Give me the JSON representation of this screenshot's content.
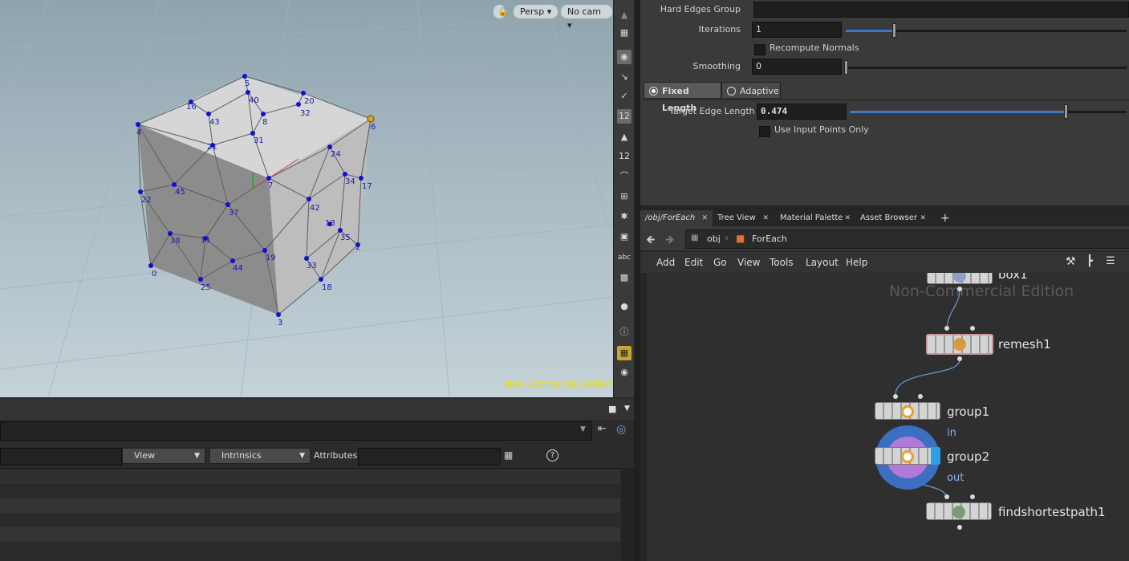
{
  "viewport": {
    "camera_view": "Persp",
    "camera": "No cam",
    "watermark": "Non-Commercial Edition",
    "point_labels": [
      "0",
      "2",
      "3",
      "4",
      "5",
      "6",
      "7",
      "8",
      "11",
      "13",
      "16",
      "17",
      "18",
      "19",
      "20",
      "21",
      "22",
      "24",
      "25",
      "31",
      "32",
      "33",
      "34",
      "35",
      "37",
      "38",
      "40",
      "42",
      "43",
      "44",
      "45"
    ]
  },
  "vertical_toolbar": {
    "icons": [
      "select-icon",
      "brush-icon",
      "pen-icon",
      "display-point-numbers-icon",
      "paint-icon",
      "numbers-icon",
      "curve-icon",
      "snap-icon",
      "tangent-icon",
      "wireframe-icon",
      "text-abc-icon",
      "background-image-icon",
      "pin-icon",
      "info-icon",
      "grid-icon",
      "eye-icon"
    ],
    "abc_label": "abc"
  },
  "params": {
    "hard_edges_group_label": "Hard Edges Group",
    "hard_edges_group_value": "",
    "iterations_label": "Iterations",
    "iterations_value": "1",
    "iterations_fraction": 0.17,
    "recompute_normals_label": "Recompute Normals",
    "smoothing_label": "Smoothing",
    "smoothing_value": "0",
    "smoothing_fraction": 0.0,
    "tab_fixed": "Fixed Length",
    "tab_adaptive": "Adaptive",
    "target_edge_label": "Target Edge Length",
    "target_edge_value": "0.474",
    "target_edge_fraction": 0.78,
    "use_input_points_label": "Use Input Points Only"
  },
  "tabs": [
    "/obj/ForEach",
    "Tree View",
    "Material Palette",
    "Asset Browser"
  ],
  "path": {
    "root": "obj",
    "current": "ForEach"
  },
  "network_menu": [
    "Add",
    "Edit",
    "Go",
    "View",
    "Tools",
    "Layout",
    "Help"
  ],
  "network": {
    "watermark": "Non-Commercial Edition",
    "nodes": [
      {
        "name": "box1",
        "sub": ""
      },
      {
        "name": "remesh1",
        "sub": ""
      },
      {
        "name": "group1",
        "sub": "in"
      },
      {
        "name": "group2",
        "sub": "out"
      },
      {
        "name": "findshortestpath1",
        "sub": ""
      }
    ]
  },
  "spreadsheet": {
    "view_label": "View",
    "intrinsics_label": "Intrinsics",
    "attributes_label": "Attributes:",
    "attributes_value": ""
  },
  "colors": {
    "accent": "#3e78c8",
    "viewport_text": "#1a1aa8",
    "selected_point": "#e0a020",
    "watermark_yellow": "#e6e000"
  }
}
